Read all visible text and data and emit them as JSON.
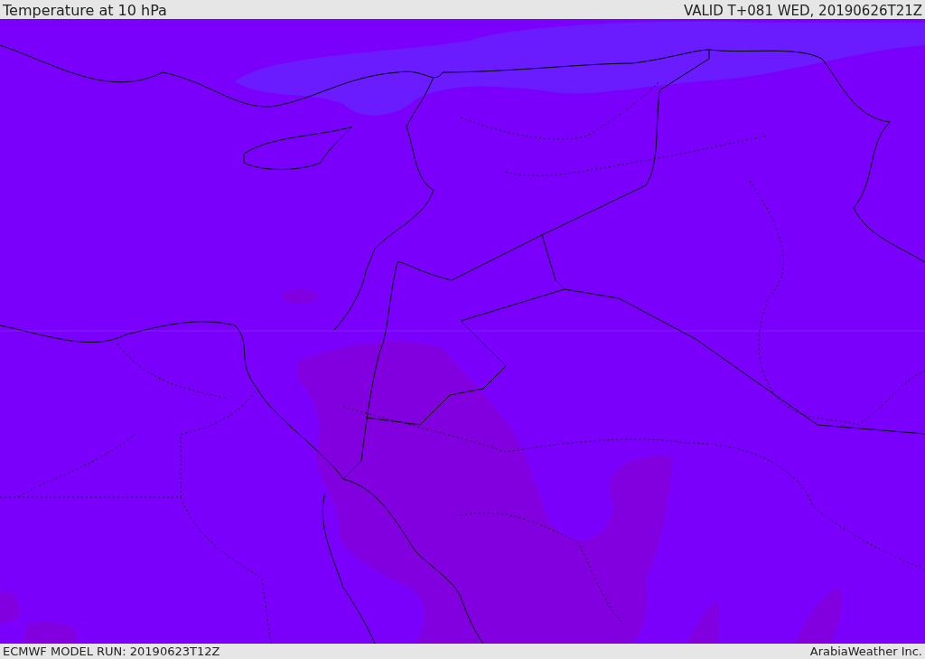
{
  "header": {
    "title": "Temperature at 10 hPa",
    "valid_time": "VALID T+081 WED, 20190626T21Z"
  },
  "footer": {
    "model_run": "ECMWF MODEL RUN: 20190623T12Z",
    "credit": "ArabiaWeather Inc."
  }
}
